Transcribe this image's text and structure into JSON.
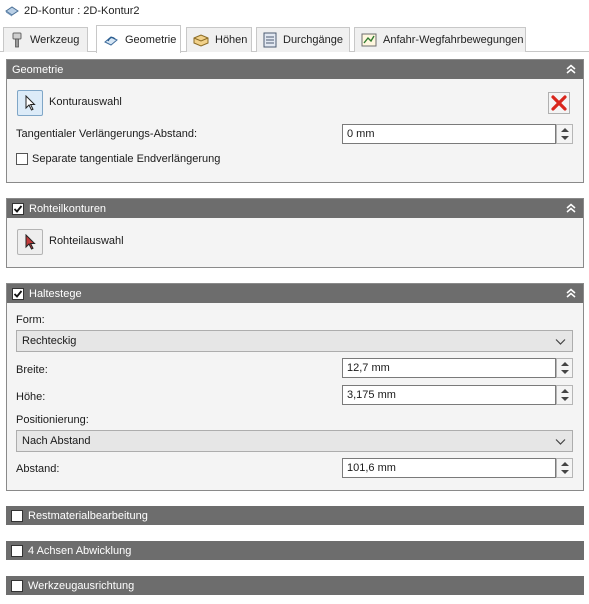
{
  "window": {
    "title": "2D-Kontur : 2D-Kontur2"
  },
  "tabs": [
    {
      "label": "Werkzeug",
      "icon": "tool-icon"
    },
    {
      "label": "Geometrie",
      "icon": "geometry-icon"
    },
    {
      "label": "Höhen",
      "icon": "heights-icon"
    },
    {
      "label": "Durchgänge",
      "icon": "passes-icon"
    },
    {
      "label": "Anfahr-Wegfahrbewegungen",
      "icon": "linking-icon"
    }
  ],
  "geometry": {
    "title": "Geometrie",
    "contour_selection_label": "Konturauswahl",
    "tangential_label": "Tangentialer Verlängerungs-Abstand:",
    "tangential_value": "0 mm",
    "separate_label": "Separate tangentiale Endverlängerung",
    "separate_checked": false
  },
  "stock": {
    "title": "Rohteilkonturen",
    "checked": true,
    "selection_label": "Rohteilauswahl"
  },
  "tabs_section": {
    "title": "Haltestege",
    "checked": true,
    "form_label": "Form:",
    "form_value": "Rechteckig",
    "width_label": "Breite:",
    "width_value": "12,7 mm",
    "height_label": "Höhe:",
    "height_value": "3,175 mm",
    "positioning_label": "Positionierung:",
    "positioning_value": "Nach Abstand",
    "distance_label": "Abstand:",
    "distance_value": "101,6 mm"
  },
  "collapsed_sections": [
    {
      "title": "Restmaterialbearbeitung",
      "checked": false
    },
    {
      "title": "4 Achsen Abwicklung",
      "checked": false
    },
    {
      "title": "Werkzeugausrichtung",
      "checked": false
    }
  ],
  "colors": {
    "section_header": "#6d6d6d",
    "delete_red": "#d9261c",
    "accent_blue": "#7fa6c7"
  }
}
